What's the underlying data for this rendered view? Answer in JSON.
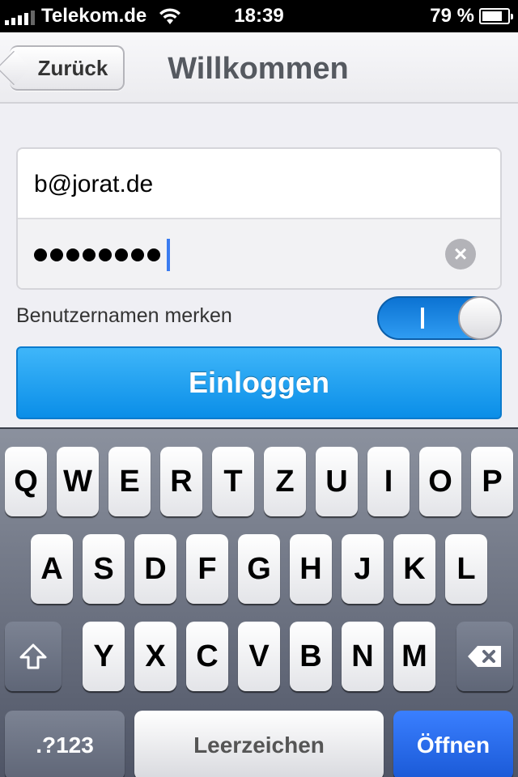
{
  "status_bar": {
    "carrier": "Telekom.de",
    "time": "18:39",
    "battery_percent": "79 %",
    "battery_level": 0.79,
    "icons": [
      "signal-icon",
      "wifi-icon",
      "battery-icon"
    ]
  },
  "navbar": {
    "back_label": "Zurück",
    "title": "Willkommen"
  },
  "form": {
    "email_value": "b@jorat.de",
    "password_length": 8,
    "clear_icon": "clear-icon"
  },
  "remember": {
    "label": "Benutzernamen merken",
    "toggle_on": true
  },
  "login_button": {
    "label": "Einloggen"
  },
  "keyboard": {
    "row1": [
      "Q",
      "W",
      "E",
      "R",
      "T",
      "Z",
      "U",
      "I",
      "O",
      "P"
    ],
    "row2": [
      "A",
      "S",
      "D",
      "F",
      "G",
      "H",
      "J",
      "K",
      "L"
    ],
    "row3": [
      "Y",
      "X",
      "C",
      "V",
      "B",
      "N",
      "M"
    ],
    "numbers_label": ".?123",
    "space_label": "Leerzeichen",
    "return_label": "Öffnen",
    "shift_icon": "shift-icon",
    "delete_icon": "backspace-icon"
  },
  "colors": {
    "accent_blue": "#1a8ff0",
    "toggle_blue": "#1a84e0",
    "return_blue": "#2a6cf0"
  }
}
